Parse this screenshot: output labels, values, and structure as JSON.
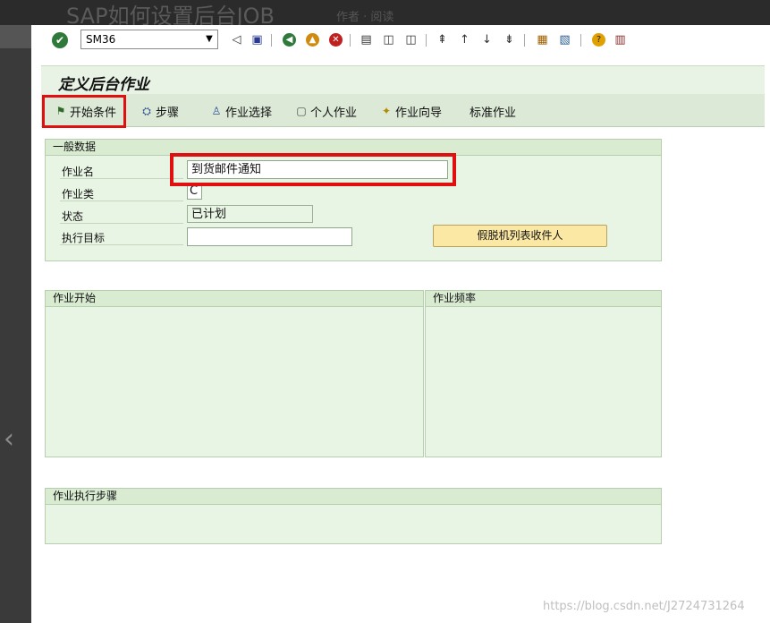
{
  "header": {
    "title": "SAP如何设置后台JOB",
    "sub": "作者 · 阅读"
  },
  "system_toolbar": {
    "command_value": "SM36",
    "icons": [
      "ok-icon",
      "back-icon",
      "save-icon",
      "back-green-icon",
      "exit-icon",
      "cancel-icon",
      "print-icon",
      "find-icon",
      "find-next-icon",
      "first-page-icon",
      "prev-page-icon",
      "next-page-icon",
      "last-page-icon",
      "new-session-icon",
      "shortcut-icon",
      "help-icon",
      "layout-icon"
    ]
  },
  "screen": {
    "title": "定义后台作业"
  },
  "app_toolbar": {
    "start_condition": "开始条件",
    "steps": "步骤",
    "job_selection": "作业选择",
    "own_jobs": "个人作业",
    "job_wizard": "作业向导",
    "standard_jobs": "标准作业"
  },
  "general_data": {
    "header": "一般数据",
    "job_name_label": "作业名",
    "job_name_value": "到货邮件通知",
    "job_class_label": "作业类",
    "job_class_value": "C",
    "status_label": "状态",
    "status_value": "已计划",
    "exec_target_label": "执行目标",
    "exec_target_value": "",
    "spool_button": "假脱机列表收件人"
  },
  "job_start": {
    "header": "作业开始"
  },
  "job_frequency": {
    "header": "作业频率"
  },
  "job_steps": {
    "header": "作业执行步骤"
  },
  "watermark": "https://blog.csdn.net/J2724731264"
}
